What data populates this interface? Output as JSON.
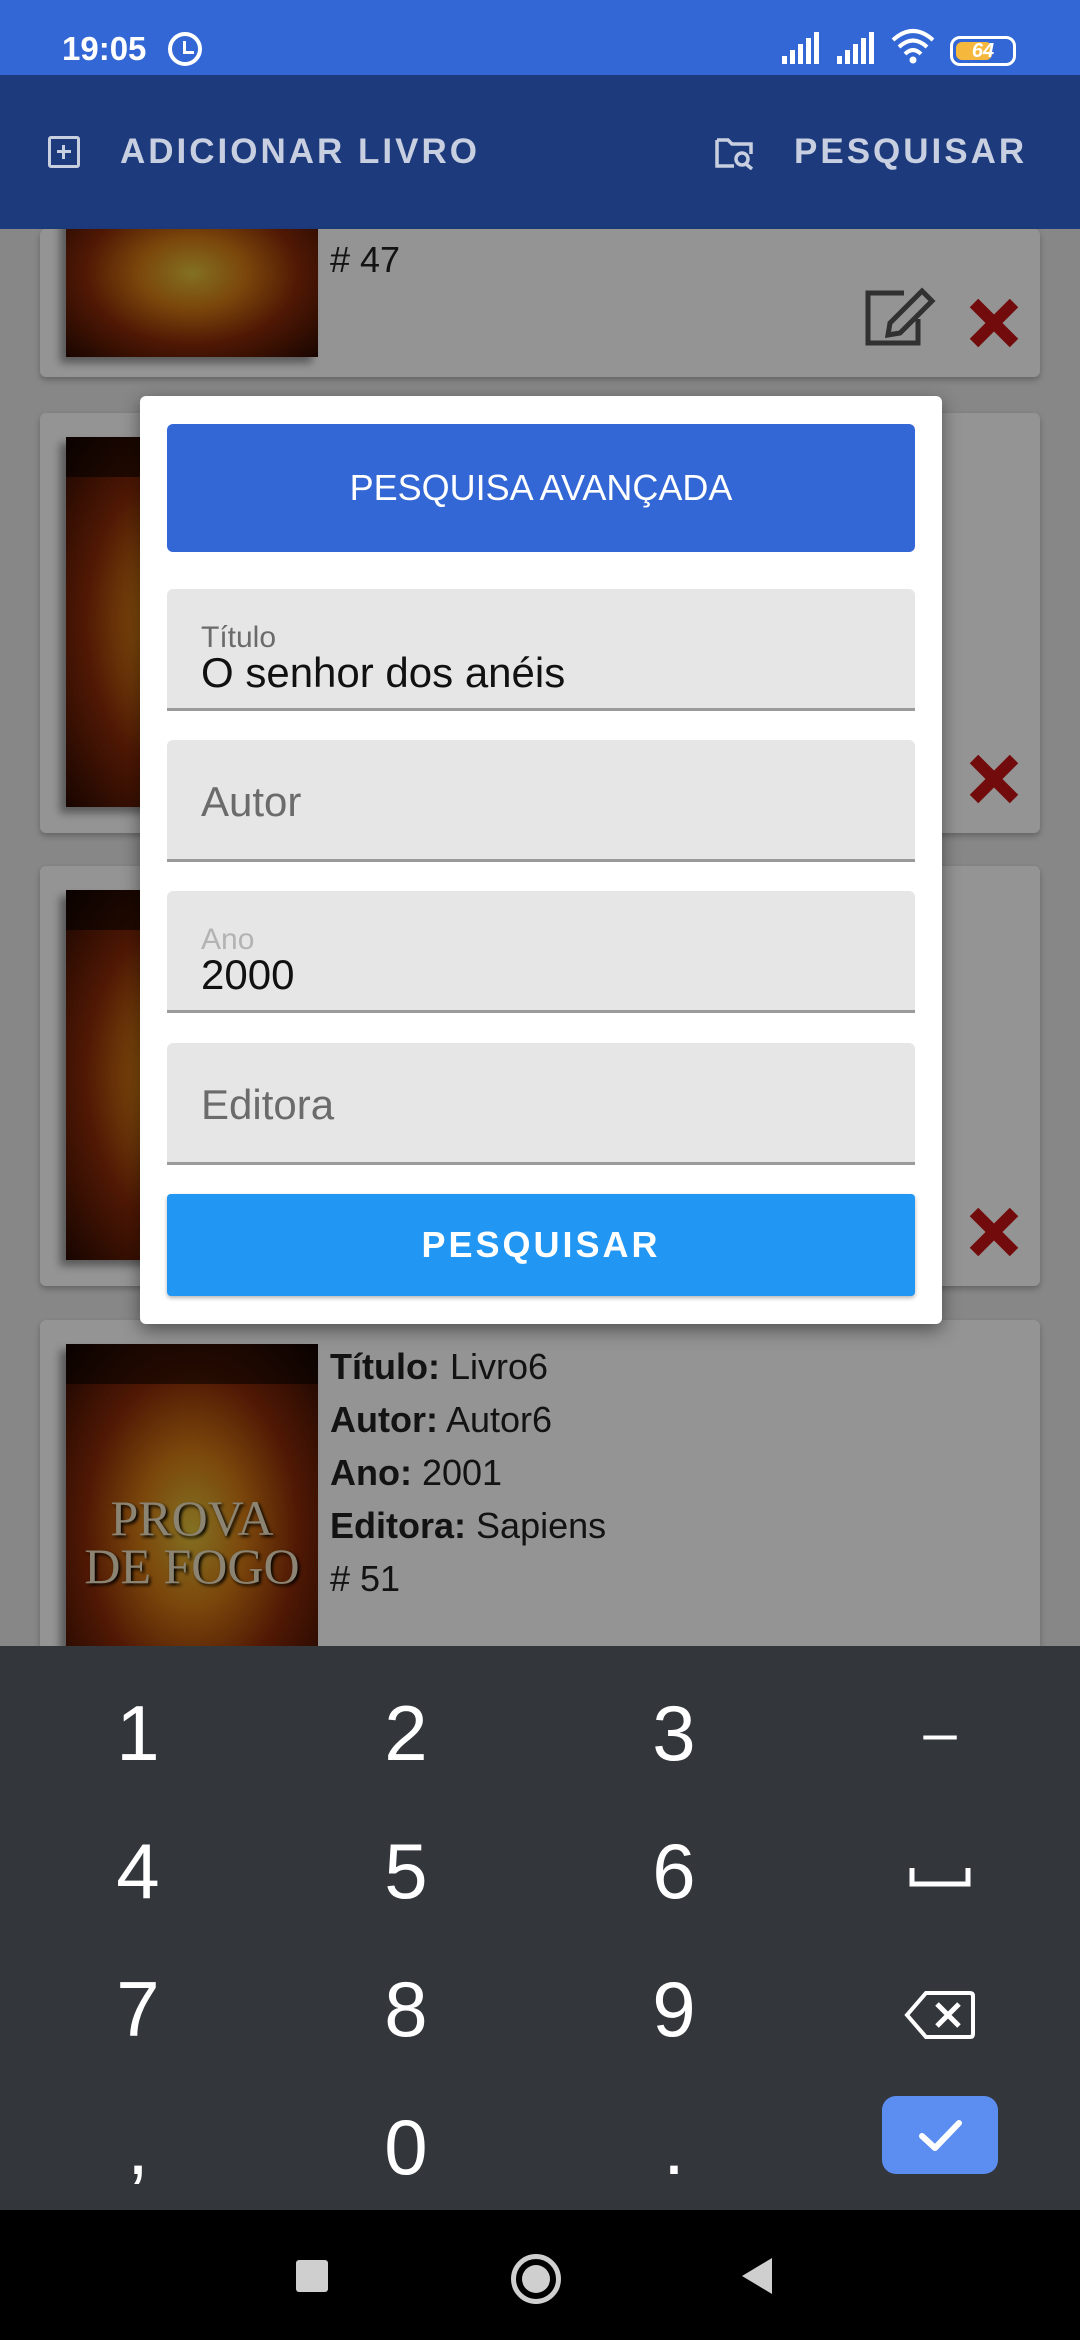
{
  "status_bar": {
    "time": "19:05",
    "battery": "64",
    "icons": [
      "alarm-icon",
      "signal-icon",
      "signal-icon",
      "wifi-icon",
      "battery-icon"
    ]
  },
  "toolbar": {
    "add_label": "ADICIONAR LIVRO",
    "add_icon": "add-box-icon",
    "search_label": "PESQUISAR",
    "search_icon": "folder-search-icon"
  },
  "cards": [
    {
      "number": "# 47"
    },
    {},
    {},
    {
      "cover_title": "PROVA DE FOGO",
      "title_label": "Título:",
      "title": "Livro6",
      "author_label": "Autor:",
      "author": "Autor6",
      "year_label": "Ano:",
      "year": "2001",
      "publisher_label": "Editora:",
      "publisher": "Sapiens",
      "number": "# 51"
    }
  ],
  "dialog": {
    "header": "PESQUISA AVANÇADA",
    "fields": {
      "titulo": {
        "label": "Título",
        "value": "O senhor dos anéis"
      },
      "autor": {
        "placeholder": "Autor"
      },
      "ano": {
        "label": "Ano",
        "value": "2000"
      },
      "editora": {
        "placeholder": "Editora"
      }
    },
    "search_button": "PESQUISAR"
  },
  "keyboard": {
    "keys": [
      "1",
      "2",
      "3",
      "–",
      "4",
      "5",
      "6",
      "␣",
      "7",
      "8",
      "9",
      "⌫",
      ",",
      "0",
      ".",
      "✓"
    ]
  },
  "colors": {
    "status_bar": "#3367d6",
    "toolbar": "#1d3a7c",
    "dialog_header": "#3367d6",
    "search_button": "#2196f3",
    "delete_icon": "#c41414",
    "keyboard": "#33373c",
    "keyboard_done": "#5b8ef0"
  }
}
